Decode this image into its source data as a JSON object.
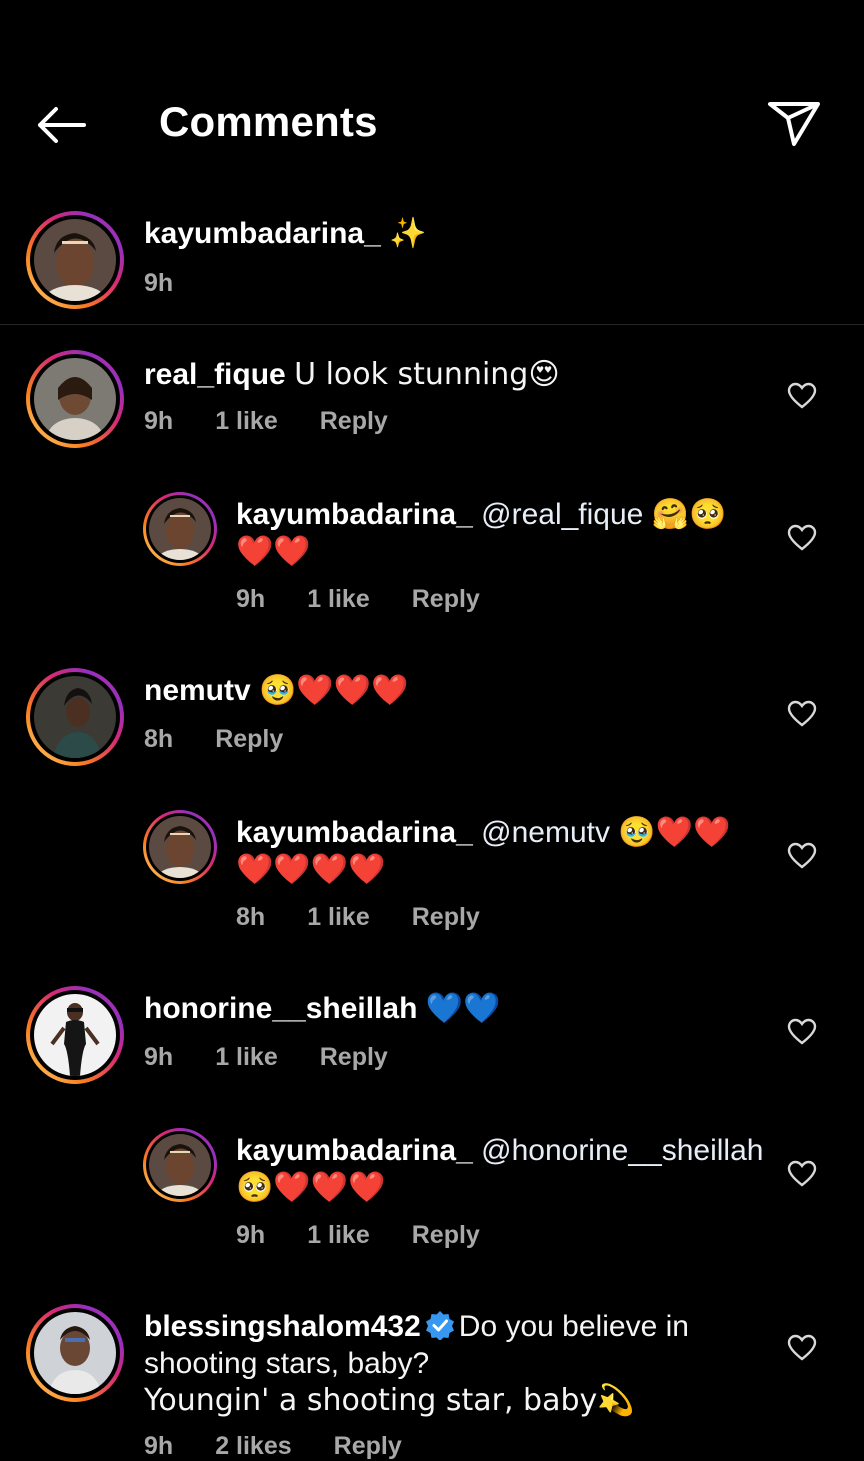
{
  "header": {
    "title": "Comments",
    "back_icon": "arrow-left-icon",
    "share_icon": "send-paper-plane-icon"
  },
  "caption": {
    "username": "kayumbadarina_",
    "text": "✨",
    "time": "9h"
  },
  "comments": [
    {
      "username": "real_fique",
      "text": "U look stunning😍",
      "time": "9h",
      "likes": "1 like",
      "reply_label": "Reply"
    },
    {
      "username": "kayumbadarina_",
      "mention": "@real_fique",
      "text": "🤗🥺 ❤️❤️",
      "time": "9h",
      "likes": "1 like",
      "reply_label": "Reply",
      "is_reply": true
    },
    {
      "username": "nemutv",
      "text": "🥹❤️❤️❤️",
      "time": "8h",
      "reply_label": "Reply"
    },
    {
      "username": "kayumbadarina_",
      "mention": "@nemutv",
      "text": "🥹❤️❤️ ❤️❤️❤️❤️",
      "time": "8h",
      "likes": "1 like",
      "reply_label": "Reply",
      "is_reply": true
    },
    {
      "username": "honorine__sheillah",
      "text": "💙💙",
      "time": "9h",
      "likes": "1 like",
      "reply_label": "Reply"
    },
    {
      "username": "kayumbadarina_",
      "mention": "@honorine__sheillah",
      "text": "🥺❤️❤️❤️",
      "time": "9h",
      "likes": "1 like",
      "reply_label": "Reply",
      "is_reply": true
    },
    {
      "username": "blessingshalom432",
      "verified": true,
      "text_line1": "Do you believe in",
      "text_line2": "shooting stars, baby?",
      "text_line3": "Youngin' a shooting star, baby💫",
      "time": "9h",
      "likes": "2 likes",
      "reply_label": "Reply"
    }
  ],
  "colors": {
    "background": "#000000",
    "text": "#f5f5f5",
    "meta": "#a8a8a8",
    "verified": "#3897f0",
    "heart_red": "#e0242c",
    "heart_blue": "#2f8fe8"
  }
}
